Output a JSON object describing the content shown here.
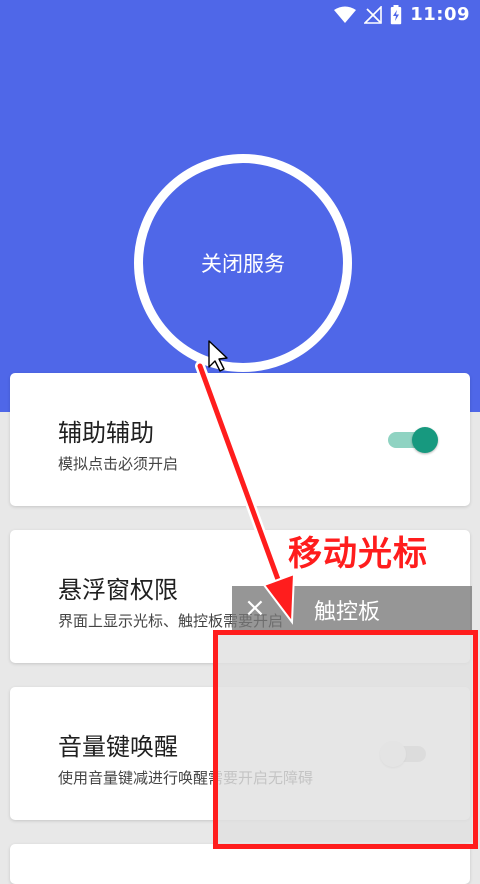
{
  "status_bar": {
    "time": "11:09",
    "icons": [
      "wifi-icon",
      "no-signal-icon",
      "battery-charging-icon"
    ]
  },
  "service_button": {
    "label": "关闭服务"
  },
  "cards": [
    {
      "title": "辅助辅助",
      "subtitle": "模拟点击必须开启",
      "toggle_on": true
    },
    {
      "title": "悬浮窗权限",
      "subtitle": "界面上显示光标、触控板需要开启"
    },
    {
      "title": "音量键唤醒",
      "subtitle": "使用音量键减进行唤醒需要开启无障碍",
      "toggle_on": false
    }
  ],
  "touchpad": {
    "close_symbol": "×",
    "title": "触控板"
  },
  "annotation": {
    "text": "移动光标"
  },
  "colors": {
    "primary": "#4f67e8",
    "accent": "#17997f",
    "highlight": "#ff1d1d"
  }
}
